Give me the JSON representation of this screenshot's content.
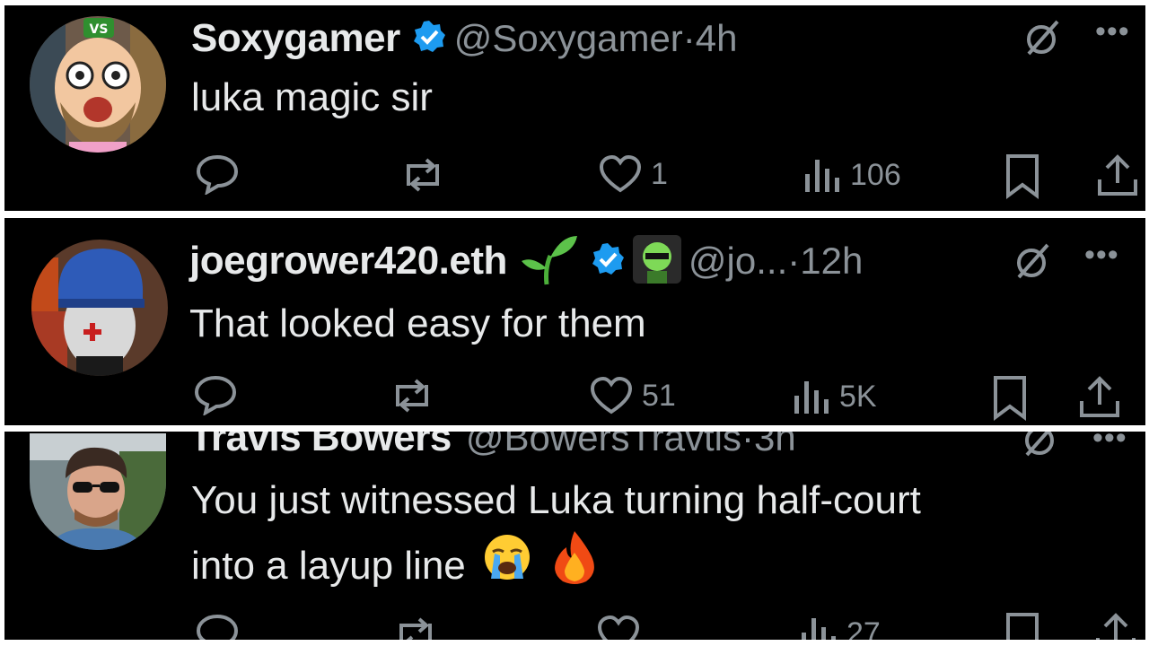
{
  "tweets": [
    {
      "name": "Soxygamer",
      "handle": "@Soxygamer",
      "separator": "·",
      "time": "4h",
      "text": "luka magic sir",
      "likes": "1",
      "views": "106",
      "avatar_badge": "VS"
    },
    {
      "name": "joegrower420.eth",
      "name_emoji": "seedling-icon",
      "handle": "@jo...",
      "separator": "·",
      "time": "12h",
      "text": "That looked easy for them",
      "likes": "51",
      "views": "5K"
    },
    {
      "name": "Travis Bowers",
      "handle": "@BowersTravtis",
      "separator": "·",
      "time": "3h",
      "text_line1": "You just witnessed Luka turning half-court",
      "text_line2": "into a layup line",
      "text_emojis": [
        "loudly-crying-face-icon",
        "fire-icon"
      ],
      "views": "27"
    }
  ],
  "icons": {
    "reply": "reply-icon",
    "repost": "repost-icon",
    "like": "heart-icon",
    "views": "views-icon",
    "bookmark": "bookmark-icon",
    "share": "share-icon",
    "grok": "grok-icon",
    "more": "more-icon",
    "verified": "verified-badge-icon"
  },
  "colors": {
    "background": "#000000",
    "text": "#e7e9ea",
    "secondary": "#8b9298",
    "verified": "#1d9bf0",
    "separator": "#ffffff"
  },
  "more_label": "•••"
}
